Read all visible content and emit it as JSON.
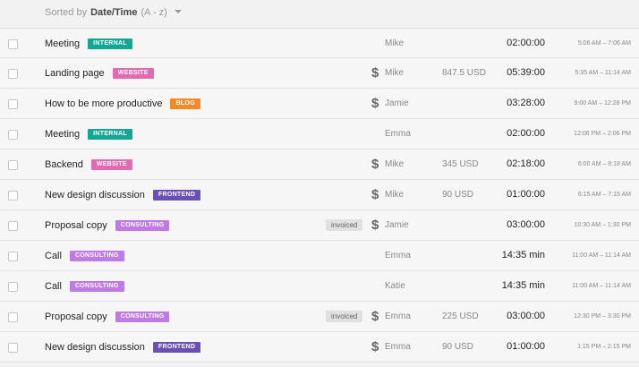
{
  "sort": {
    "prefix": "Sorted by",
    "field": "Date/Time",
    "order": "(A - z)"
  },
  "tag_colors": {
    "INTERNAL": "#13a793",
    "WEBSITE": "#e26ab2",
    "BLOG": "#f38a2a",
    "FRONTEND": "#6a4fb5",
    "CONSULTING": "#c07ae3"
  },
  "entries": [
    {
      "description": "Meeting",
      "tag": "INTERNAL",
      "invoiced": "",
      "billable": false,
      "user": "Mike",
      "amount": "",
      "duration": "02:00:00",
      "time_range": "5:06 AM – 7:06 AM"
    },
    {
      "description": "Landing page",
      "tag": "WEBSITE",
      "invoiced": "",
      "billable": true,
      "user": "Mike",
      "amount": "847.5 USD",
      "duration": "05:39:00",
      "time_range": "5:35 AM – 11:14 AM"
    },
    {
      "description": "How to be more productive",
      "tag": "BLOG",
      "invoiced": "",
      "billable": true,
      "user": "Jamie",
      "amount": "",
      "duration": "03:28:00",
      "time_range": "9:00 AM – 12:28 PM"
    },
    {
      "description": "Meeting",
      "tag": "INTERNAL",
      "invoiced": "",
      "billable": false,
      "user": "Emma",
      "amount": "",
      "duration": "02:00:00",
      "time_range": "12:06 PM – 2:06 PM"
    },
    {
      "description": "Backend",
      "tag": "WEBSITE",
      "invoiced": "",
      "billable": true,
      "user": "Mike",
      "amount": "345 USD",
      "duration": "02:18:00",
      "time_range": "6:00 AM – 8:18 AM"
    },
    {
      "description": "New design discussion",
      "tag": "FRONTEND",
      "invoiced": "",
      "billable": true,
      "user": "Mike",
      "amount": "90 USD",
      "duration": "01:00:00",
      "time_range": "6:15 AM – 7:15 AM"
    },
    {
      "description": "Proposal copy",
      "tag": "CONSULTING",
      "invoiced": "invoiced",
      "billable": true,
      "user": "Jamie",
      "amount": "",
      "duration": "03:00:00",
      "time_range": "10:30 AM – 1:30 PM"
    },
    {
      "description": "Call",
      "tag": "CONSULTING",
      "invoiced": "",
      "billable": false,
      "user": "Emma",
      "amount": "",
      "duration": "14:35 min",
      "time_range": "11:00 AM – 11:14 AM"
    },
    {
      "description": "Call",
      "tag": "CONSULTING",
      "invoiced": "",
      "billable": false,
      "user": "Katie",
      "amount": "",
      "duration": "14:35 min",
      "time_range": "11:00 AM – 11:14 AM"
    },
    {
      "description": "Proposal copy",
      "tag": "CONSULTING",
      "invoiced": "invoiced",
      "billable": true,
      "user": "Emma",
      "amount": "225 USD",
      "duration": "03:00:00",
      "time_range": "12:30 PM – 3:30 PM"
    },
    {
      "description": "New design discussion",
      "tag": "FRONTEND",
      "invoiced": "",
      "billable": true,
      "user": "Emma",
      "amount": "90 USD",
      "duration": "01:00:00",
      "time_range": "1:15 PM – 2:15 PM"
    }
  ],
  "icons": {
    "billable": "dollar-icon",
    "sort_toggle": "caret-down-icon",
    "select": "checkbox"
  },
  "billable_symbol": "$"
}
